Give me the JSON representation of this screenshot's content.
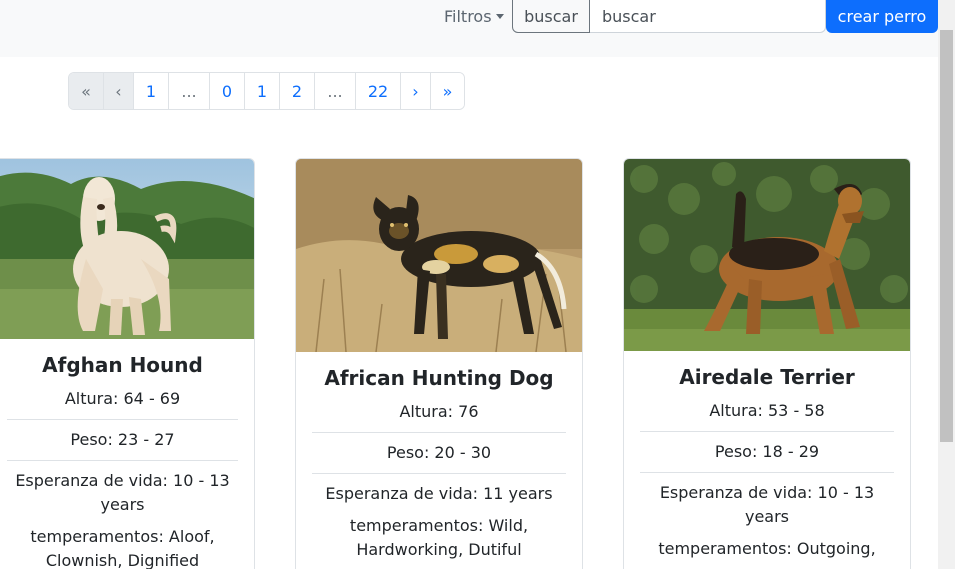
{
  "navbar": {
    "filters_label": "Filtros",
    "search_button_label": "buscar",
    "search_placeholder": "buscar",
    "create_button_label": "crear perro"
  },
  "pagination": [
    "«",
    "‹",
    "1",
    "...",
    "0",
    "1",
    "2",
    "...",
    "22",
    "›",
    "»"
  ],
  "cards": [
    {
      "name": "Afghan Hound",
      "height": "Altura: 64 - 69",
      "weight": "Peso: 23 - 27",
      "life_span": "Esperanza de vida: 10 - 13 years",
      "temperaments": "temperamentos: Aloof, Clownish, Dignified"
    },
    {
      "name": "African Hunting Dog",
      "height": "Altura: 76",
      "weight": "Peso: 20 - 30",
      "life_span": "Esperanza de vida: 11 years",
      "temperaments": "temperamentos: Wild, Hardworking, Dutiful"
    },
    {
      "name": "Airedale Terrier",
      "height": "Altura: 53 - 58",
      "weight": "Peso: 18 - 29",
      "life_span": "Esperanza de vida: 10 - 13 years",
      "temperaments": "temperamentos: Outgoing,"
    }
  ]
}
